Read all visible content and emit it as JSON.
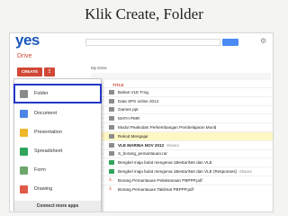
{
  "slide": {
    "title": "Klik Create, Folder"
  },
  "app": {
    "logo": "yes",
    "section_title": "Drive",
    "create_label": "CREATE",
    "upload_label": "⇪"
  },
  "menu": {
    "items": [
      {
        "label": "Folder",
        "icon": "folder-icon"
      },
      {
        "label": "Document",
        "icon": "document-icon"
      },
      {
        "label": "Presentation",
        "icon": "presentation-icon"
      },
      {
        "label": "Spreadsheet",
        "icon": "spreadsheet-icon"
      },
      {
        "label": "Form",
        "icon": "form-icon"
      },
      {
        "label": "Drawing",
        "icon": "drawing-icon"
      }
    ],
    "connect": "Connect more apps"
  },
  "main": {
    "breadcrumb": "My Drive",
    "column_title": "TITLE",
    "rows": [
      {
        "name": "Bahan VLE Frog",
        "type": "folder",
        "shared": ""
      },
      {
        "name": "Data SPS online 2014",
        "type": "folder",
        "shared": ""
      },
      {
        "name": "Games ppt",
        "type": "folder",
        "shared": ""
      },
      {
        "name": "MATH PMR",
        "type": "folder",
        "shared": ""
      },
      {
        "name": "Modul Peakodan Perkembangan Pembelajaran Murid",
        "type": "folder",
        "shared": ""
      },
      {
        "name": "Rekod Mengajar",
        "type": "folder",
        "shared": ""
      },
      {
        "name": "VLE MARINA NOV 2012",
        "type": "folder",
        "shared": "Shared",
        "bold": true
      },
      {
        "name": "S_borang_pemantauan.rar",
        "type": "folder",
        "shared": ""
      },
      {
        "name": "Bengkel maja bulat mengenai 1BestariNet dan VLE",
        "type": "sheet",
        "shared": ""
      },
      {
        "name": "Bengkel maja bulat mengenai 1BestariNet dan VLE (Responses)",
        "type": "sheet",
        "shared": "Shared"
      },
      {
        "name": "Borang Pemantauan Pelaksanaan PBPPP.pdf",
        "type": "pdf",
        "shared": ""
      },
      {
        "name": "Borang Pemantauan Taklimat PBPPP.pdf",
        "type": "pdf",
        "shared": ""
      }
    ]
  }
}
